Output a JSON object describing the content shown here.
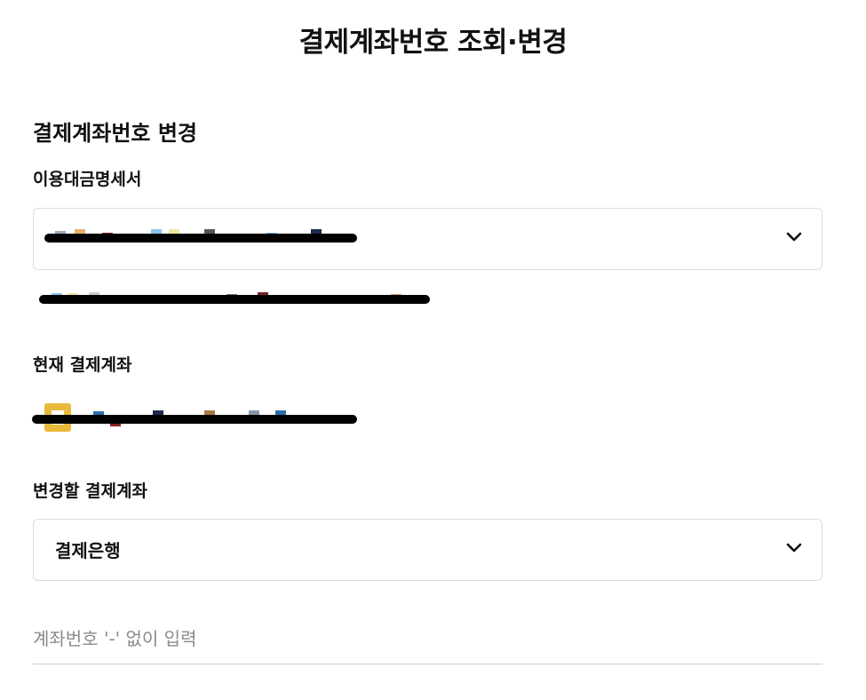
{
  "page": {
    "title": "결제계좌번호 조회·변경"
  },
  "section": {
    "title": "결제계좌번호 변경"
  },
  "statement": {
    "label": "이용대금명세서",
    "selected": "",
    "chevron_icon": "chevron-down-icon"
  },
  "current_account": {
    "label": "현재 결제계좌"
  },
  "new_account": {
    "label": "변경할 결제계좌",
    "bank_select": {
      "selected": "결제은행",
      "chevron_icon": "chevron-down-icon"
    },
    "account_input": {
      "value": "",
      "placeholder": "계좌번호 '-' 없이 입력"
    }
  }
}
